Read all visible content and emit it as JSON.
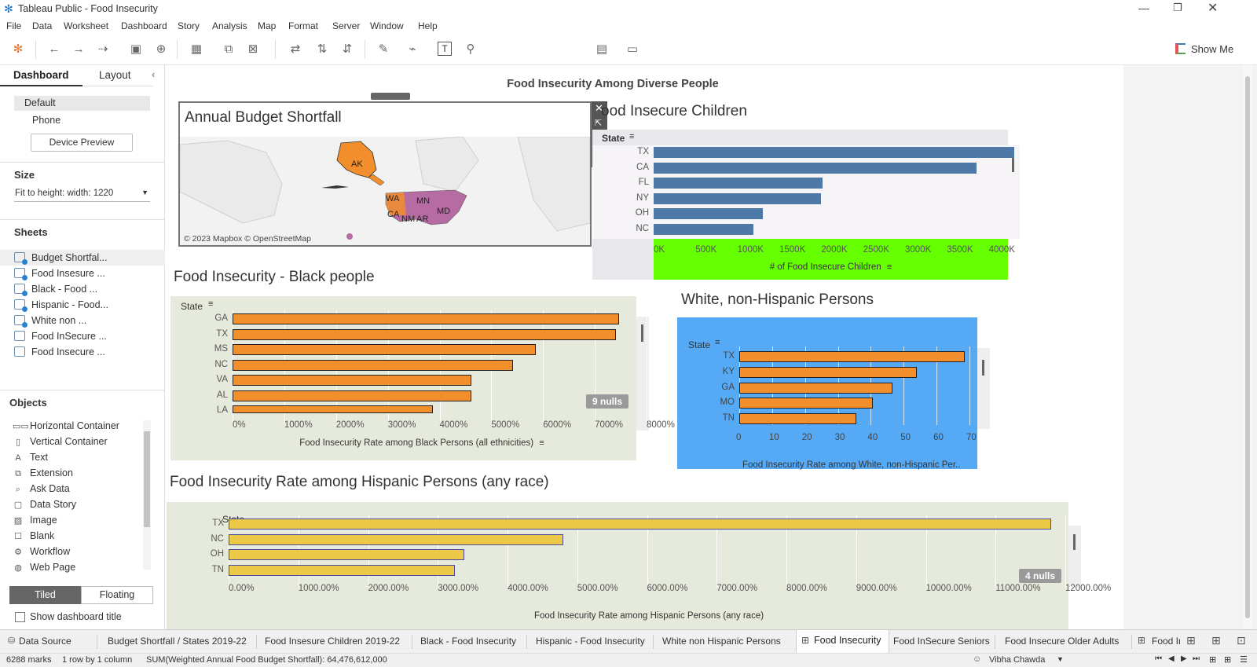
{
  "window": {
    "title": "Tableau Public - Food Insecurity"
  },
  "menu": [
    "File",
    "Data",
    "Worksheet",
    "Dashboard",
    "Story",
    "Analysis",
    "Map",
    "Format",
    "Server",
    "Window",
    "Help"
  ],
  "toolbar": {
    "show_me": "Show Me"
  },
  "left": {
    "tabs": {
      "dashboard": "Dashboard",
      "layout": "Layout"
    },
    "devices": {
      "default": "Default",
      "phone": "Phone",
      "preview": "Device Preview"
    },
    "size": {
      "heading": "Size",
      "value": "Fit to height: width: 1220"
    },
    "sheets": {
      "heading": "Sheets",
      "items": [
        "Budget Shortfal...",
        "Food Insesure ...",
        "Black - Food ...",
        "Hispanic - Food...",
        "White non ...",
        "Food InSecure ...",
        "Food Insecure ..."
      ]
    },
    "objects": {
      "heading": "Objects",
      "items": [
        "Horizontal Container",
        "Vertical Container",
        "Text",
        "Extension",
        "Ask Data",
        "Data Story",
        "Image",
        "Blank",
        "Workflow",
        "Web Page"
      ]
    },
    "tiled": "Tiled",
    "floating": "Floating",
    "show_title": "Show dashboard title"
  },
  "dashboard": {
    "title": "Food Insecurity Among Diverse People",
    "map": {
      "title": "Annual Budget Shortfall",
      "credit": "© 2023 Mapbox © OpenStreetMap",
      "labels": [
        "AK",
        "WA",
        "MN",
        "CA",
        "NM",
        "AR",
        "MD"
      ]
    },
    "children": {
      "title": "ood Insecure  Children",
      "row_header": "State",
      "axis_title": "# of Food Insecure Children"
    },
    "black": {
      "title": "Food Insecurity - Black people",
      "row_header": "State",
      "axis_title": "Food Insecurity Rate among Black Persons (all ethnicities)",
      "nulls": "9 nulls"
    },
    "white": {
      "title": "White, non-Hispanic Persons",
      "row_header": "State",
      "axis_title": "Food Insecurity Rate among White, non-Hispanic Per.."
    },
    "hispanic": {
      "title": "Food Insecurity Rate among Hispanic Persons (any race)",
      "row_header": "State",
      "axis_title": "Food Insecurity Rate among Hispanic Persons (any race)",
      "nulls": "4 nulls"
    }
  },
  "colors": {
    "accent": "#1f4e79",
    "children_bar": "#4e79a7",
    "orange_bar": "#f28e2b",
    "yellow_bar": "#edc948",
    "green_axis": "#66ff00",
    "blue_bg": "#56aaf5",
    "sage_bg": "#e6eadc"
  },
  "chart_data": [
    {
      "type": "bar",
      "id": "children",
      "categories": [
        "TX",
        "CA",
        "FL",
        "NY",
        "OH",
        "NC"
      ],
      "values": [
        4300000,
        3850000,
        2020000,
        2000000,
        1300000,
        1190000
      ],
      "xlabel": "# of Food Insecure Children",
      "ylabel": "State",
      "xlim": [
        0,
        4500000
      ],
      "ticks": [
        "0K",
        "500K",
        "1000K",
        "1500K",
        "2000K",
        "2500K",
        "3000K",
        "3500K",
        "4000K"
      ]
    },
    {
      "type": "bar",
      "id": "black",
      "categories": [
        "GA",
        "TX",
        "MS",
        "NC",
        "VA",
        "AL",
        "LA"
      ],
      "values": [
        8400,
        8330,
        6600,
        6100,
        5200,
        5200,
        4350
      ],
      "xlabel": "Food Insecurity Rate among Black Persons (all ethnicities)",
      "ylabel": "State",
      "xlim": [
        0,
        9000
      ],
      "ticks": [
        "0%",
        "1000%",
        "2000%",
        "3000%",
        "4000%",
        "5000%",
        "6000%",
        "7000%",
        "8000%"
      ]
    },
    {
      "type": "bar",
      "id": "white",
      "categories": [
        "TX",
        "KY",
        "GA",
        "MO",
        "TN"
      ],
      "values": [
        68.5,
        54,
        46.5,
        40.5,
        35.5
      ],
      "xlabel": "Food Insecurity Rate among White, non-Hispanic Per..",
      "ylabel": "State",
      "xlim": [
        0,
        70
      ],
      "ticks": [
        "0",
        "10",
        "20",
        "30",
        "40",
        "50",
        "60",
        "70"
      ]
    },
    {
      "type": "bar",
      "id": "hispanic",
      "categories": [
        "TX",
        "NC",
        "OH",
        "TN"
      ],
      "values": [
        11800,
        4800,
        3380,
        3250
      ],
      "xlabel": "Food Insecurity Rate among Hispanic Persons (any race)",
      "ylabel": "State",
      "xlim": [
        0,
        12000
      ],
      "ticks": [
        "0.00%",
        "1000.00%",
        "2000.00%",
        "3000.00%",
        "4000.00%",
        "5000.00%",
        "6000.00%",
        "7000.00%",
        "8000.00%",
        "9000.00%",
        "10000.00%",
        "11000.00%",
        "12000.00%"
      ]
    }
  ],
  "tabs": [
    "Data Source",
    "Budget Shortfall / States 2019-22",
    "Food Insesure Children 2019-22",
    "Black - Food Insecurity",
    "Hispanic - Food Insecurity",
    "White non Hispanic Persons",
    "Food Insecurity",
    "Food InSecure Seniors",
    "Food Insecure Older Adults",
    "Food In"
  ],
  "status": {
    "marks": "6288 marks",
    "rows": "1 row by 1 column",
    "sum": "SUM(Weighted Annual Food Budget Shortfall): 64,476,612,000",
    "user": "Vibha Chawda"
  }
}
